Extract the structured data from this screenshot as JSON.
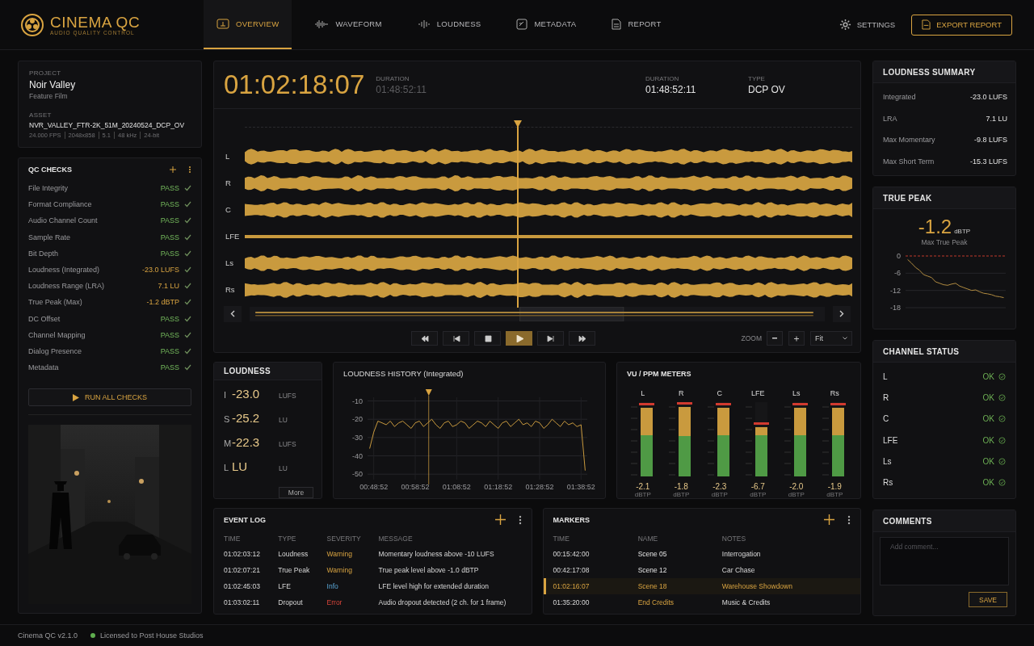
{
  "app": {
    "name": "CINEMA QC",
    "subtitle": "AUDIO QUALITY CONTROL"
  },
  "nav": [
    {
      "label": "OVERVIEW",
      "selected": true
    },
    {
      "label": "WAVEFORM",
      "selected": false
    },
    {
      "label": "LOUDNESS",
      "selected": false
    },
    {
      "label": "METADATA",
      "selected": false
    },
    {
      "label": "REPORT",
      "selected": false
    }
  ],
  "settings": "SETTINGS",
  "export_button": "EXPORT REPORT",
  "project": {
    "label": "PROJECT",
    "name": "Noir Valley",
    "type": "Feature Film",
    "asset_label": "ASSET",
    "asset": "NVR_VALLEY_FTR-2K_51M_20240524_DCP_OV",
    "specs": [
      "24.000 FPS",
      "2048x858",
      "5.1",
      "48 kHz",
      "24-bit"
    ]
  },
  "qc_checks": {
    "title": "QC CHECKS",
    "items": [
      {
        "name": "File Integrity",
        "result": "PASS",
        "kind": "pass"
      },
      {
        "name": "Format Compliance",
        "result": "PASS",
        "kind": "pass"
      },
      {
        "name": "Audio Channel Count",
        "result": "PASS",
        "kind": "pass"
      },
      {
        "name": "Sample Rate",
        "result": "PASS",
        "kind": "pass"
      },
      {
        "name": "Bit Depth",
        "result": "PASS",
        "kind": "pass"
      },
      {
        "name": "Loudness (Integrated)",
        "result": "-23.0 LUFS",
        "kind": "value"
      },
      {
        "name": "Loudness Range (LRA)",
        "result": "7.1 LU",
        "kind": "value"
      },
      {
        "name": "True Peak (Max)",
        "result": "-1.2 dBTP",
        "kind": "value"
      },
      {
        "name": "DC Offset",
        "result": "PASS",
        "kind": "pass"
      },
      {
        "name": "Channel Mapping",
        "result": "PASS",
        "kind": "pass"
      },
      {
        "name": "Dialog Presence",
        "result": "PASS",
        "kind": "pass"
      },
      {
        "name": "Metadata",
        "result": "PASS",
        "kind": "pass"
      }
    ],
    "run_button": "RUN ALL CHECKS"
  },
  "timecode": {
    "current": "01:02:18:07",
    "label": "DURATION",
    "value": "01:48:52:11"
  },
  "info": [
    {
      "label": "DURATION",
      "value": "01:48:52:11"
    },
    {
      "label": "TYPE",
      "value": "DCP OV"
    }
  ],
  "waveform": {
    "channels": [
      "L",
      "R",
      "C",
      "LFE",
      "Ls",
      "Rs"
    ],
    "playhead": {
      "level": 0.449
    }
  },
  "transport": [
    {
      "kind": "skip-back",
      "selected": false
    },
    {
      "kind": "step-back",
      "selected": false
    },
    {
      "kind": "stop",
      "selected": false
    },
    {
      "kind": "play",
      "selected": true
    },
    {
      "kind": "step-forward",
      "selected": false
    },
    {
      "kind": "skip-forward",
      "selected": false
    }
  ],
  "zoom": {
    "label": "ZOOM",
    "value": "Fit"
  },
  "loudness": {
    "title": "LOUDNESS",
    "rows": [
      {
        "key": "I",
        "value": "-23.0",
        "unit": "LUFS"
      },
      {
        "key": "S",
        "value": "-25.2",
        "unit": "LU"
      },
      {
        "key": "M",
        "value": "-22.3",
        "unit": "LUFS"
      },
      {
        "key": "L",
        "value": "LU",
        "unit": "LU"
      }
    ],
    "more": "More"
  },
  "loudness_history": {
    "title": "LOUDNESS HISTORY (Integrated)",
    "chart_data": {
      "type": "line",
      "categories": [
        null,
        "00:48:52",
        null,
        null,
        null,
        null,
        null,
        null,
        null,
        null,
        null,
        "00:58:52",
        null,
        null,
        null,
        null,
        null,
        null,
        null,
        null,
        null,
        "01:08:52",
        null,
        null,
        null,
        null,
        null,
        null,
        null,
        null,
        null,
        "01:18:52",
        null,
        null,
        null,
        null,
        null,
        null,
        null,
        null,
        null,
        "01:28:52",
        null,
        null,
        null,
        null,
        null,
        null,
        null,
        null,
        null,
        "01:38:52",
        null
      ],
      "values": [
        -36,
        -27,
        -21,
        -22,
        -23,
        -21,
        -24,
        -22,
        -21,
        -23,
        -25,
        -22,
        -21,
        -24,
        -22,
        -20,
        -23,
        -25,
        -22,
        -21,
        -24,
        -23,
        -21,
        -22,
        -25,
        -23,
        -21,
        -22,
        -24,
        -21,
        -23,
        -25,
        -22,
        -21,
        -24,
        -22,
        -20,
        -23,
        -22,
        -24,
        -21,
        -22,
        -25,
        -23,
        -20,
        -22,
        -24,
        -21,
        -23,
        -22,
        -24,
        -23,
        -48
      ],
      "ylim": [
        -53,
        -8
      ],
      "yticks": [
        -10,
        -20,
        -30,
        -40,
        -50
      ],
      "grid": true
    }
  },
  "vu_meters": {
    "title": "VU / PPM METERS",
    "meters": [
      {
        "name": "L",
        "level": 0.92,
        "reading": "-2.1",
        "unit": "dBTP"
      },
      {
        "name": "R",
        "level": 0.94,
        "reading": "-1.8",
        "unit": "dBTP"
      },
      {
        "name": "C",
        "level": 0.92,
        "reading": "-2.3",
        "unit": "dBTP"
      },
      {
        "name": "LFE",
        "level": 0.66,
        "reading": "-6.7",
        "unit": "dBTP"
      },
      {
        "name": "Ls",
        "level": 0.92,
        "reading": "-2.0",
        "unit": "dBTP"
      },
      {
        "name": "Rs",
        "level": 0.92,
        "reading": "-1.9",
        "unit": "dBTP"
      }
    ]
  },
  "loudness_summary": {
    "title": "LOUDNESS SUMMARY",
    "rows": [
      {
        "label": "Integrated",
        "value": "-23.0 LUFS"
      },
      {
        "label": "LRA",
        "value": "7.1 LU"
      },
      {
        "label": "Max Momentary",
        "value": "-9.8 LUFS"
      },
      {
        "label": "Max Short Term",
        "value": "-15.3 LUFS"
      }
    ]
  },
  "true_peak": {
    "title": "TRUE PEAK",
    "value": "-1.2",
    "unit": "dBTP",
    "caption": "Max True Peak",
    "chart_data": {
      "type": "line",
      "categories": [
        null,
        null,
        null,
        null,
        null,
        null,
        null,
        null,
        null,
        null,
        null,
        null,
        null,
        null,
        null,
        null,
        null,
        null,
        null,
        null,
        null,
        null,
        null,
        null,
        null
      ],
      "values": [
        -1.2,
        -2.5,
        -4,
        -5,
        -6.5,
        -7,
        -7.5,
        -9,
        -9.5,
        -10,
        -10.2,
        -9.8,
        -9.5,
        -10.5,
        -11,
        -11.5,
        -12,
        -11.8,
        -12.5,
        -13,
        -13.2,
        -13.5,
        -14,
        -14.2,
        -14.5
      ],
      "ylim": [
        -18,
        0
      ],
      "yticks": [
        0,
        -6,
        -12,
        -18
      ],
      "grid": true
    }
  },
  "channel_status": {
    "title": "CHANNEL STATUS",
    "rows": [
      {
        "name": "L",
        "status": "OK"
      },
      {
        "name": "R",
        "status": "OK"
      },
      {
        "name": "C",
        "status": "OK"
      },
      {
        "name": "LFE",
        "status": "OK"
      },
      {
        "name": "Ls",
        "status": "OK"
      },
      {
        "name": "Rs",
        "status": "OK"
      }
    ]
  },
  "event_log": {
    "title": "EVENT LOG",
    "columns": [
      "TIME",
      "TYPE",
      "SEVERITY",
      "MESSAGE"
    ],
    "rows": [
      {
        "time": "01:02:03:12",
        "type": "Loudness",
        "severity": "Warning",
        "kind": "warning",
        "message": "Momentary loudness above -10 LUFS"
      },
      {
        "time": "01:02:07:21",
        "type": "True Peak",
        "severity": "Warning",
        "kind": "warning",
        "message": "True peak level above -1.0 dBTP"
      },
      {
        "time": "01:02:45:03",
        "type": "LFE",
        "severity": "Info",
        "kind": "info",
        "message": "LFE level high for extended duration"
      },
      {
        "time": "01:03:02:11",
        "type": "Dropout",
        "severity": "Error",
        "kind": "error",
        "message": "Audio dropout detected (2 ch. for 1 frame)"
      }
    ]
  },
  "markers": {
    "title": "MARKERS",
    "columns": [
      "TIME",
      "NAME",
      "NOTES"
    ],
    "rows": [
      {
        "time": "00:15:42:00",
        "name": "Scene 05",
        "notes": "Interrogation",
        "highlighted": false,
        "selected": false
      },
      {
        "time": "00:42:17:08",
        "name": "Scene 12",
        "notes": "Car Chase",
        "highlighted": false,
        "selected": false
      },
      {
        "time": "01:02:16:07",
        "name": "Scene 18",
        "notes": "Warehouse Showdown",
        "highlighted": true,
        "selected": true
      },
      {
        "time": "01:35:20:00",
        "name": "End Credits",
        "notes": "Music & Credits",
        "highlighted": true,
        "selected": false
      }
    ]
  },
  "comments": {
    "title": "COMMENTS",
    "placeholder": "Add comment...",
    "button": "SAVE"
  },
  "footer": {
    "version": "Cinema QC v2.1.0",
    "license": "Licensed to Post House Studios"
  }
}
